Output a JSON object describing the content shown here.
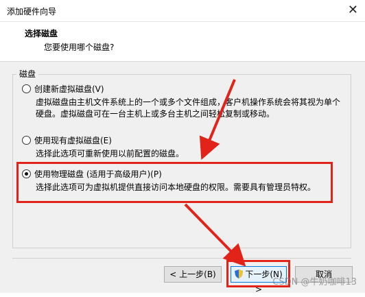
{
  "window": {
    "title": "添加硬件向导",
    "close_glyph": "✕"
  },
  "header": {
    "title": "选择磁盘",
    "subtitle": "您要使用哪个磁盘?"
  },
  "group": {
    "label": "磁盘"
  },
  "options": [
    {
      "label": "创建新虚拟磁盘(V)",
      "desc1": "虚拟磁盘由主机文件系统上的一个或多个文件组成，客户机操作系统会将其视为单个",
      "desc2": "硬盘。虚拟磁盘可在一台主机上或多台主机之间轻松复制或移动。",
      "selected": false
    },
    {
      "label": "使用现有虚拟磁盘(E)",
      "desc1": "选择此选项可重新使用以前配置的磁盘。",
      "selected": false
    },
    {
      "label": "使用物理磁盘 (适用于高级用户)(P)",
      "desc1": "选择此选项可为虚拟机提供直接访问本地硬盘的权限。需要具有管理员特权。",
      "selected": true
    }
  ],
  "buttons": {
    "back": "< 上一步(B)",
    "next": "下一步(N) >",
    "cancel": "取消"
  },
  "watermark": "CSDN @牛奶咖啡13",
  "colors": {
    "annotation_red": "#e2231a"
  }
}
